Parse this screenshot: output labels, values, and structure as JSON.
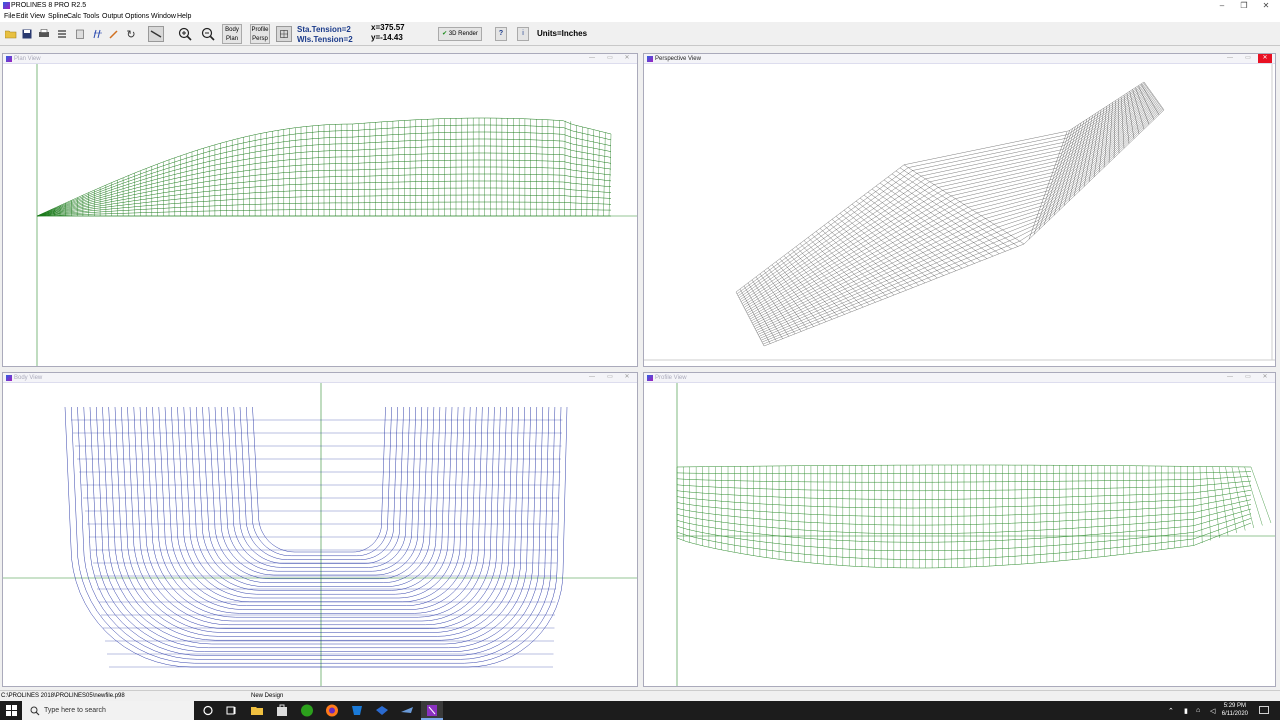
{
  "window": {
    "title": "PROLINES 8 PRO R2.5"
  },
  "menu": [
    "File",
    "Edit",
    "View",
    "Spline",
    "Calc",
    "Tools",
    "Output",
    "Options",
    "Window",
    "Help"
  ],
  "toolbar": {
    "body_plan": [
      "Body",
      "Plan"
    ],
    "profile_persp": [
      "Profile",
      "Persp"
    ],
    "sta_tension": "Sta.Tension=2",
    "wls_tension": "Wls.Tension=2",
    "x_readout": "x=375.57",
    "y_readout": "y=-14.43",
    "render_label": "3D Render",
    "help_label": "?",
    "info_label": "i",
    "units": "Units=Inches"
  },
  "views": {
    "plan": {
      "title": "Plan View"
    },
    "perspective": {
      "title": "Perspective View"
    },
    "body": {
      "title": "Body View"
    },
    "profile": {
      "title": "Profile View"
    }
  },
  "status": {
    "path": "C:\\PROLINES 2018\\PROLINES05\\newfile.p98",
    "message": "New Design"
  },
  "taskbar": {
    "search_placeholder": "Type here to search",
    "time": "5:29 PM",
    "date": "6/11/2020"
  },
  "colors": {
    "plan_lines": "#1a7a1a",
    "body_lines": "#1a2aa0",
    "profile_lines": "#2a8a2a",
    "perspective_lines": "#444444",
    "axis": "#2a8a2a"
  }
}
